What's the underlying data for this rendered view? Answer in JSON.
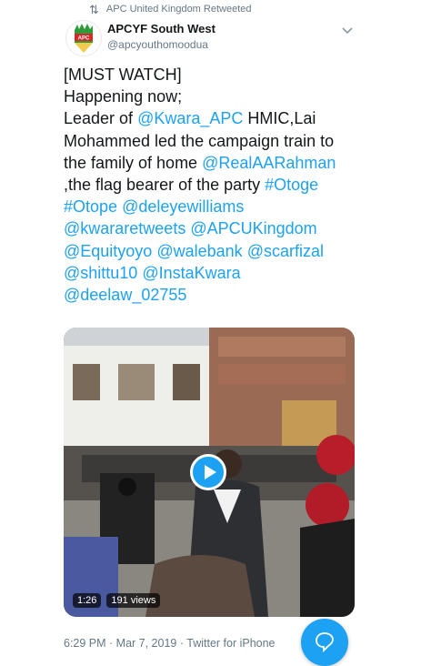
{
  "retweet": {
    "icon": "retweet-icon",
    "text": "APC United Kingdom Retweeted"
  },
  "author": {
    "display_name": "APCYF South West",
    "handle": "@apcyouthomoodua",
    "avatar_text": "APC"
  },
  "tweet": {
    "lines": [
      [
        {
          "t": "[MUST WATCH]",
          "link": false
        }
      ],
      [
        {
          "t": "Happening now;",
          "link": false
        }
      ],
      [
        {
          "t": "Leader of ",
          "link": false
        },
        {
          "t": "@Kwara_APC",
          "link": true
        },
        {
          "t": " HMIC,Lai",
          "link": false
        }
      ],
      [
        {
          "t": "Mohammed led the campaign train to",
          "link": false
        }
      ],
      [
        {
          "t": "the family of home ",
          "link": false
        },
        {
          "t": "@RealAARahman",
          "link": true
        }
      ],
      [
        {
          "t": ",the flag bearer of the party ",
          "link": false
        },
        {
          "t": "#Otoge",
          "link": true
        }
      ],
      [
        {
          "t": "#Otope",
          "link": true
        },
        {
          "t": " ",
          "link": false
        },
        {
          "t": "@deleyewilliams",
          "link": true
        }
      ],
      [
        {
          "t": "@kwararetweets",
          "link": true
        },
        {
          "t": " ",
          "link": false
        },
        {
          "t": "@APCUKingdom",
          "link": true
        }
      ],
      [
        {
          "t": "@Equityoyo",
          "link": true
        },
        {
          "t": " ",
          "link": false
        },
        {
          "t": "@walebank",
          "link": true
        },
        {
          "t": " ",
          "link": false
        },
        {
          "t": "@scarfizal",
          "link": true
        }
      ],
      [
        {
          "t": "@shittu10",
          "link": true
        },
        {
          "t": " ",
          "link": false
        },
        {
          "t": "@InstaKwara",
          "link": true
        }
      ],
      [
        {
          "t": "@deelaw_02755",
          "link": true
        }
      ]
    ]
  },
  "video": {
    "duration": "1:26",
    "views": "191 views"
  },
  "meta": {
    "line": "6:29 PM · Mar 7, 2019 · Twitter for iPhone"
  },
  "colors": {
    "accent": "#1da1f2",
    "text": "#14171a",
    "muted": "#657786"
  },
  "icons": {
    "more": "chevron-down-icon",
    "play": "play-icon",
    "compose": "reply-bubble-icon"
  }
}
